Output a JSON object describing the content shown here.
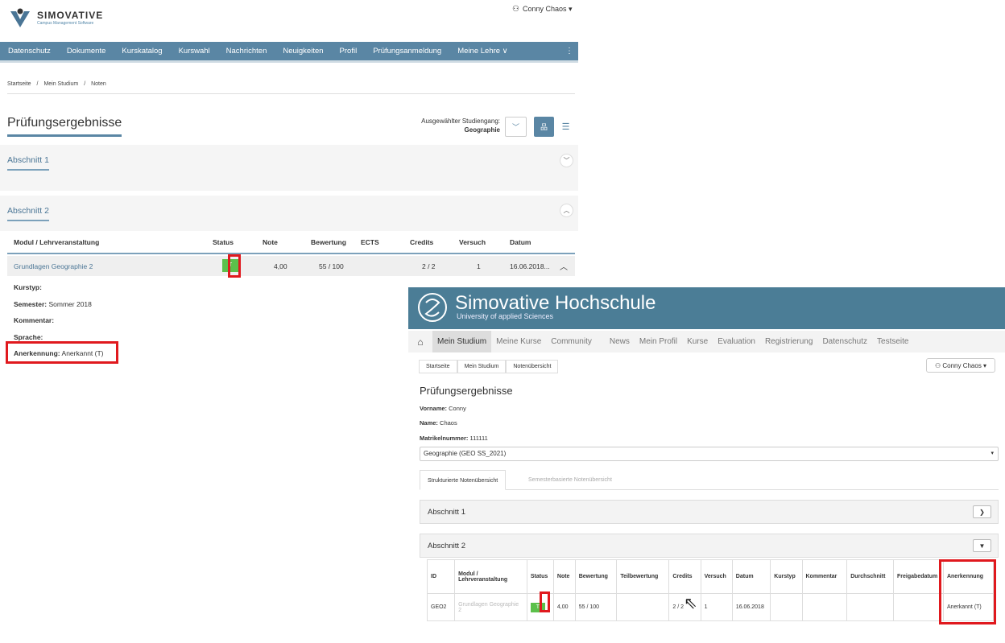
{
  "left": {
    "logo": {
      "title": "SIMOVATIVE",
      "subtitle": "Campus Management Software"
    },
    "user": "Conny Chaos ▾",
    "nav": [
      "Datenschutz",
      "Dokumente",
      "Kurskatalog",
      "Kurswahl",
      "Nachrichten",
      "Neuigkeiten",
      "Profil",
      "Prüfungsanmeldung",
      "Meine Lehre ∨"
    ],
    "breadcrumb": [
      "Startseite",
      "/",
      "Mein Studium",
      "/",
      "Noten"
    ],
    "page_title": "Prüfungsergebnisse",
    "studiengang_label": "Ausgewählter Studiengang:",
    "studiengang_value": "Geographie",
    "section1": "Abschnitt 1",
    "section2": "Abschnitt 2",
    "table": {
      "headers": [
        "Modul / Lehrveranstaltung",
        "Status",
        "Note",
        "Bewertung",
        "ECTS",
        "Credits",
        "Versuch",
        "Datum"
      ],
      "row": {
        "modul": "Grundlagen Geographie 2",
        "status": "T",
        "note": "4,00",
        "bewertung": "55 / 100",
        "ects": "",
        "credits": "2 / 2",
        "versuch": "1",
        "datum": "16.06.2018..."
      }
    },
    "details": {
      "kurstyp_label": "Kurstyp:",
      "kurstyp": "",
      "semester_label": "Semester:",
      "semester": "Sommer 2018",
      "kommentar_label": "Kommentar:",
      "kommentar": "",
      "sprache_label": "Sprache:",
      "sprache": "",
      "anerkennung_label": "Anerkennung:",
      "anerkennung": "Anerkannt (T)"
    }
  },
  "right": {
    "title": "Simovative  Hochschule",
    "subtitle": "University of applied Sciences",
    "nav": [
      "Mein Studium",
      "Meine Kurse",
      "Community",
      "News",
      "Mein Profil",
      "Kurse",
      "Evaluation",
      "Registrierung",
      "Datenschutz",
      "Testseite"
    ],
    "breadcrumb": [
      "Startseite",
      "Mein Studium",
      "Notenübersicht"
    ],
    "user": "Conny Chaos ▾",
    "page_title": "Prüfungsergebnisse",
    "vorname_label": "Vorname:",
    "vorname": "Conny",
    "name_label": "Name:",
    "name": "Chaos",
    "matrikel_label": "Matrikelnummer:",
    "matrikel": "111111",
    "studiengang_select": "Geographie (GEO SS_2021)",
    "tabs": [
      "Strukturierte Notenübersicht",
      "Semesterbasierte Notenübersicht"
    ],
    "section1": "Abschnitt 1",
    "section2": "Abschnitt 2",
    "table": {
      "headers": [
        "ID",
        "Modul / Lehrveranstaltung",
        "Status",
        "Note",
        "Bewertung",
        "Teilbewertung",
        "Credits",
        "Versuch",
        "Datum",
        "Kurstyp",
        "Kommentar",
        "Durchschnitt",
        "Freigabedatum",
        "Anerkennung"
      ],
      "row": [
        "GEO2",
        "Grundlagen Geographie 2",
        "T",
        "4,00",
        "55 / 100",
        "",
        "2 / 2",
        "1",
        "16.06.2018",
        "",
        "",
        "",
        "",
        "Anerkannt (T)"
      ]
    }
  },
  "colors": {
    "nav_blue": "#5a86a4",
    "header_blue": "#4b7d96",
    "status_green": "#5cc04b",
    "highlight_red": "#e0191e"
  }
}
